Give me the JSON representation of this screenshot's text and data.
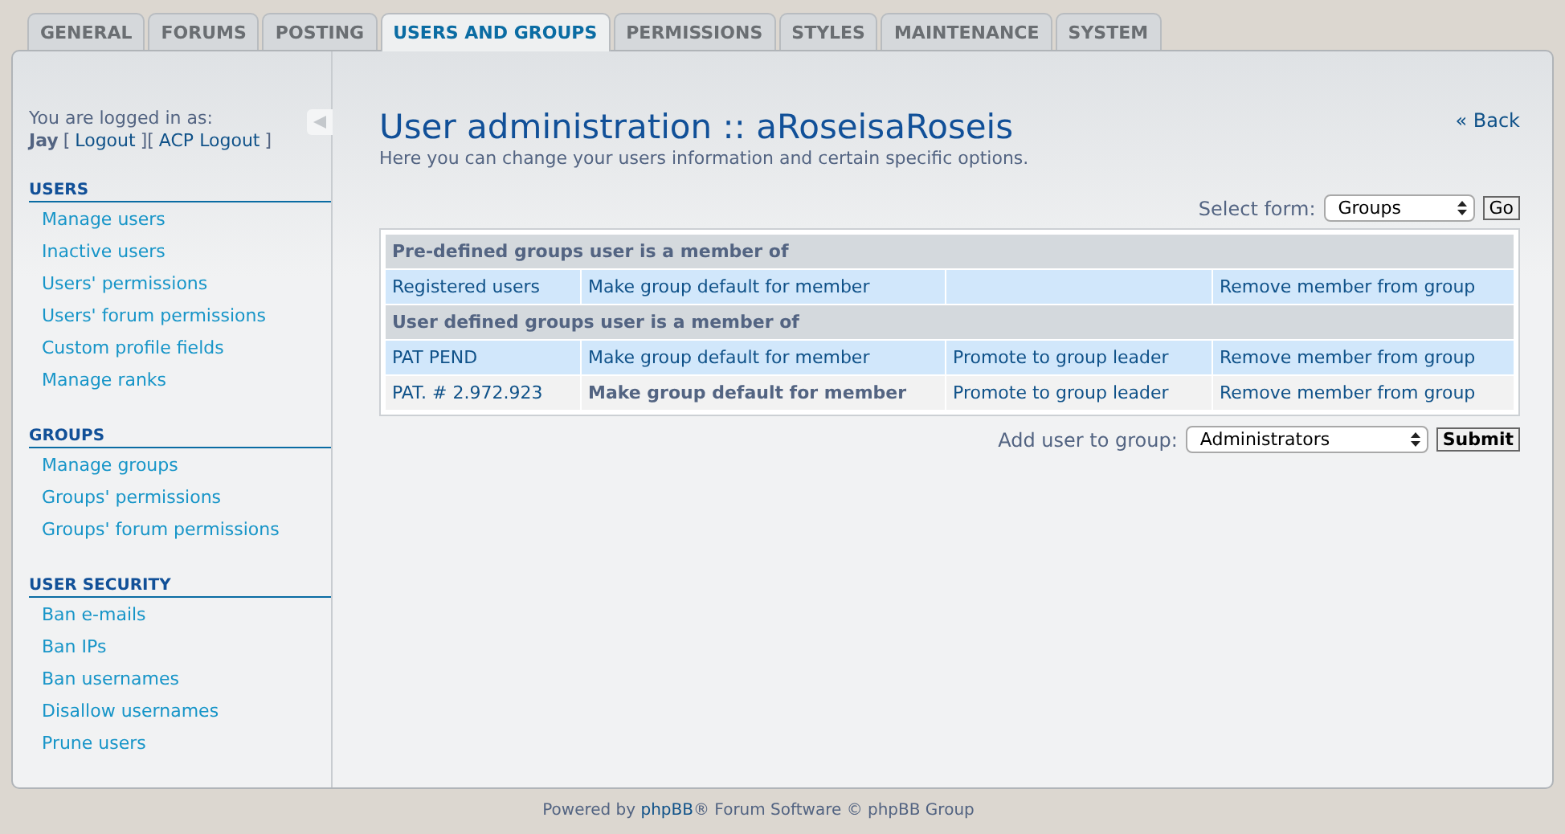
{
  "tabs": [
    {
      "label": "GENERAL",
      "selected": false
    },
    {
      "label": "FORUMS",
      "selected": false
    },
    {
      "label": "POSTING",
      "selected": false
    },
    {
      "label": "USERS AND GROUPS",
      "selected": true
    },
    {
      "label": "PERMISSIONS",
      "selected": false
    },
    {
      "label": "STYLES",
      "selected": false
    },
    {
      "label": "MAINTENANCE",
      "selected": false
    },
    {
      "label": "SYSTEM",
      "selected": false
    }
  ],
  "sidebar": {
    "login_label": "You are logged in as:",
    "user": "Jay",
    "open_bracket": "[",
    "logout": "Logout",
    "middle_bracket": "][",
    "acp_logout": "ACP Logout",
    "close_bracket": "]",
    "sections": [
      {
        "title": "USERS",
        "items": [
          "Manage users",
          "Inactive users",
          "Users' permissions",
          "Users' forum permissions",
          "Custom profile fields",
          "Manage ranks"
        ]
      },
      {
        "title": "GROUPS",
        "items": [
          "Manage groups",
          "Groups' permissions",
          "Groups' forum permissions"
        ]
      },
      {
        "title": "USER SECURITY",
        "items": [
          "Ban e-mails",
          "Ban IPs",
          "Ban usernames",
          "Disallow usernames",
          "Prune users"
        ]
      }
    ]
  },
  "main": {
    "title": "User administration :: aRoseisaRoseis",
    "description": "Here you can change your users information and certain specific options.",
    "back": "« Back",
    "select_form": {
      "label": "Select form:",
      "value": "Groups",
      "button": "Go"
    },
    "group_sections": [
      {
        "heading": "Pre-defined groups user is a member of",
        "rows": [
          {
            "group": "Registered users",
            "default_action": "Make group default for member",
            "is_default": false,
            "remove": "Remove member from group"
          }
        ]
      },
      {
        "heading": "User defined groups user is a member of",
        "rows": [
          {
            "group": "PAT PEND",
            "default_action": "Make group default for member",
            "is_default": false,
            "promote": "Promote to group leader",
            "remove": "Remove member from group"
          },
          {
            "group": "PAT. # 2.972.923",
            "default_action": "Make group default for member",
            "is_default": true,
            "promote": "Promote to group leader",
            "remove": "Remove member from group"
          }
        ]
      }
    ],
    "add_user": {
      "label": "Add user to group:",
      "value": "Administrators",
      "button": "Submit"
    }
  },
  "footer": {
    "before": "Powered by",
    "link": "phpBB",
    "after": "® Forum Software © phpBB Group"
  }
}
